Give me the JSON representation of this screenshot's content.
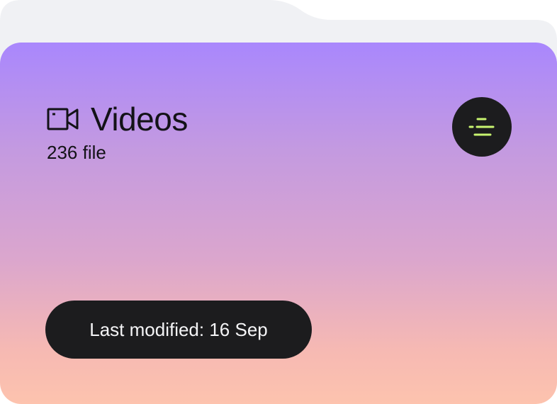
{
  "folder": {
    "title": "Videos",
    "file_count": "236 file",
    "last_modified": "Last modified: 16 Sep",
    "icon": "video-camera-icon",
    "menu_icon": "sort-lines-icon"
  },
  "colors": {
    "gradient_top": "#a987fd",
    "gradient_bottom": "#fdc3ae",
    "folder_back": "#f0f1f4",
    "dark": "#1c1c1e",
    "accent": "#c8f470"
  }
}
